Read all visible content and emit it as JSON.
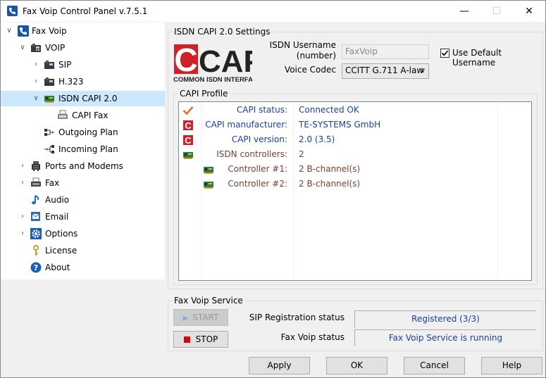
{
  "window": {
    "title": "Fax Voip Control Panel v.7.5.1"
  },
  "tree": {
    "items": [
      {
        "label": "Fax Voip"
      },
      {
        "label": "VOIP"
      },
      {
        "label": "SIP"
      },
      {
        "label": "H.323"
      },
      {
        "label": "ISDN CAPI 2.0"
      },
      {
        "label": "CAPI Fax"
      },
      {
        "label": "Outgoing Plan"
      },
      {
        "label": "Incoming Plan"
      },
      {
        "label": "Ports and Modems"
      },
      {
        "label": "Fax"
      },
      {
        "label": "Audio"
      },
      {
        "label": "Email"
      },
      {
        "label": "Options"
      },
      {
        "label": "License"
      },
      {
        "label": "About"
      }
    ]
  },
  "settings": {
    "group_title": "ISDN CAPI 2.0 Settings",
    "logo_text": "CAPI",
    "logo_subtext": "COMMON ISDN INTERFACE",
    "username_label_1": "ISDN Username",
    "username_label_2": "(number)",
    "username_value": "FaxVoip",
    "codec_label": "Voice Codec",
    "codec_value": "CCITT G.711 A-law",
    "use_default_label": "Use Default Username",
    "use_default_checked": true
  },
  "profile": {
    "group_title": "CAPI Profile",
    "rows": [
      {
        "name": "CAPI status:",
        "value": "Connected OK",
        "icon": "check-icon"
      },
      {
        "name": "CAPI manufacturer:",
        "value": "TE-SYSTEMS GmbH",
        "icon": "capi-icon"
      },
      {
        "name": "CAPI version:",
        "value": "2.0 (3.5)",
        "icon": "capi-icon"
      },
      {
        "name": "ISDN controllers:",
        "value": "2",
        "icon": "isdn-card-icon"
      },
      {
        "name": "Controller #1:",
        "value": "2 B-channel(s)",
        "icon": "isdn-card-icon"
      },
      {
        "name": "Controller #2:",
        "value": "2 B-channel(s)",
        "icon": "isdn-card-icon"
      }
    ]
  },
  "service": {
    "group_title": "Fax Voip Service",
    "start_label": "START",
    "stop_label": "STOP",
    "sip_status_label": "SIP Registration status",
    "sip_status_value": "Registered (3/3)",
    "service_status_label": "Fax Voip status",
    "service_status_value": "Fax Voip Service is running"
  },
  "footer": {
    "apply": "Apply",
    "ok": "OK",
    "cancel": "Cancel",
    "help": "Help"
  },
  "colors": {
    "selection": "#cce8ff",
    "link_blue": "#1c3ea5",
    "brown": "#7a3f2c",
    "capi_red": "#d0202a"
  }
}
